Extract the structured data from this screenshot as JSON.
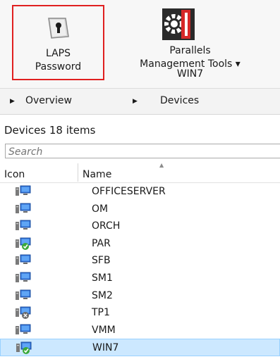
{
  "ribbon": {
    "laps_line1": "LAPS",
    "laps_line2": "Password",
    "parallels_line1": "Parallels",
    "parallels_line2": "Management Tools ▾",
    "group_label": "WIN7"
  },
  "breadcrumb": {
    "items": [
      "Overview",
      "Devices"
    ]
  },
  "panel": {
    "title": "Devices 18 items",
    "search_placeholder": "Search",
    "columns": [
      "Icon",
      "Name"
    ]
  },
  "devices": [
    {
      "name": "OFFICESERVER",
      "status": "normal"
    },
    {
      "name": "OM",
      "status": "normal"
    },
    {
      "name": "ORCH",
      "status": "normal"
    },
    {
      "name": "PAR",
      "status": "ok"
    },
    {
      "name": "SFB",
      "status": "normal"
    },
    {
      "name": "SM1",
      "status": "normal"
    },
    {
      "name": "SM2",
      "status": "normal"
    },
    {
      "name": "TP1",
      "status": "error"
    },
    {
      "name": "VMM",
      "status": "normal"
    },
    {
      "name": "WIN7",
      "status": "ok",
      "selected": true
    }
  ]
}
